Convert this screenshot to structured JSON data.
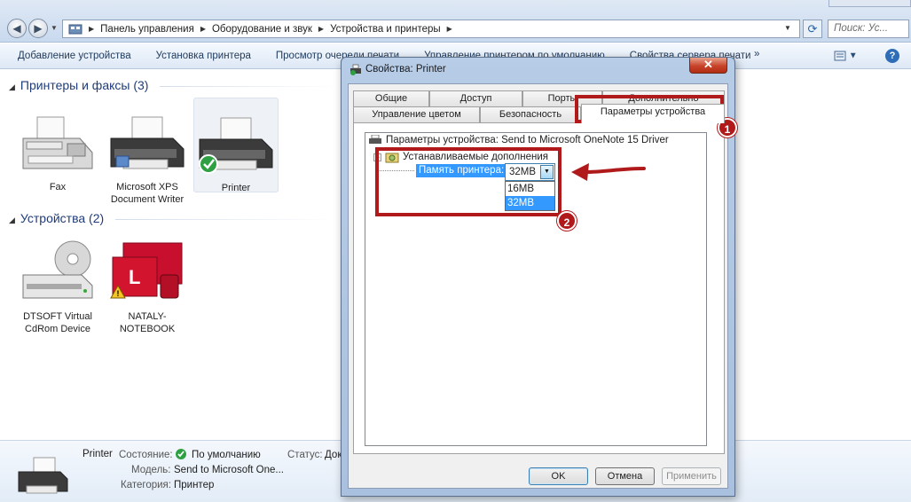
{
  "explorer": {
    "nav": {
      "back": "◀",
      "forward": "▶"
    },
    "breadcrumb": [
      "Панель управления",
      "Оборудование и звук",
      "Устройства и принтеры"
    ],
    "search_placeholder": "Поиск: Ус...",
    "toolbar": [
      "Добавление устройства",
      "Установка принтера",
      "Просмотр очереди печати",
      "Управление принтером по умолчанию",
      "Свойства сервера печати"
    ],
    "toolbar_more": "»",
    "help": "?",
    "groups": [
      {
        "title": "Принтеры и факсы (3)"
      },
      {
        "title": "Устройства (2)"
      }
    ],
    "printers": [
      {
        "label": "Fax",
        "icon": "fax-icon"
      },
      {
        "label": "Microsoft XPS Document Writer",
        "icon": "printer-icon"
      },
      {
        "label": "Printer",
        "icon": "printer-default-icon"
      }
    ],
    "devices": [
      {
        "label": "DTSOFT Virtual CdRom Device",
        "icon": "cdrom-drive-icon"
      },
      {
        "label": "NATALY-NOTEBOOK",
        "icon": "computer-icon"
      }
    ],
    "details": {
      "name": "Printer",
      "state_label": "Состояние:",
      "state_value": "По умолчанию",
      "status_label": "Статус:",
      "status_value": "Док",
      "model_label": "Модель:",
      "model_value": "Send to Microsoft One...",
      "category_label": "Категория:",
      "category_value": "Принтер"
    }
  },
  "dialog": {
    "title": "Свойства: Printer",
    "close": "✕",
    "tabs_row1": [
      "Общие",
      "Доступ",
      "Порты",
      "Дополнительно"
    ],
    "tabs_row2": [
      "Управление цветом",
      "Безопасность",
      "Параметры устройства"
    ],
    "active_tab": "Параметры устройства",
    "tree": {
      "root": "Параметры устройства: Send to Microsoft OneNote 15 Driver",
      "child": "Устанавливаемые дополнения",
      "setting_label": "Память принтера:",
      "setting_value": "32MB",
      "options": [
        "16MB",
        "32MB"
      ],
      "selected_option": "32MB"
    },
    "buttons": {
      "ok": "OK",
      "cancel": "Отмена",
      "apply": "Применить"
    }
  },
  "annotations": {
    "badge1": "1",
    "badge2": "2",
    "color": "#b11a1a"
  }
}
